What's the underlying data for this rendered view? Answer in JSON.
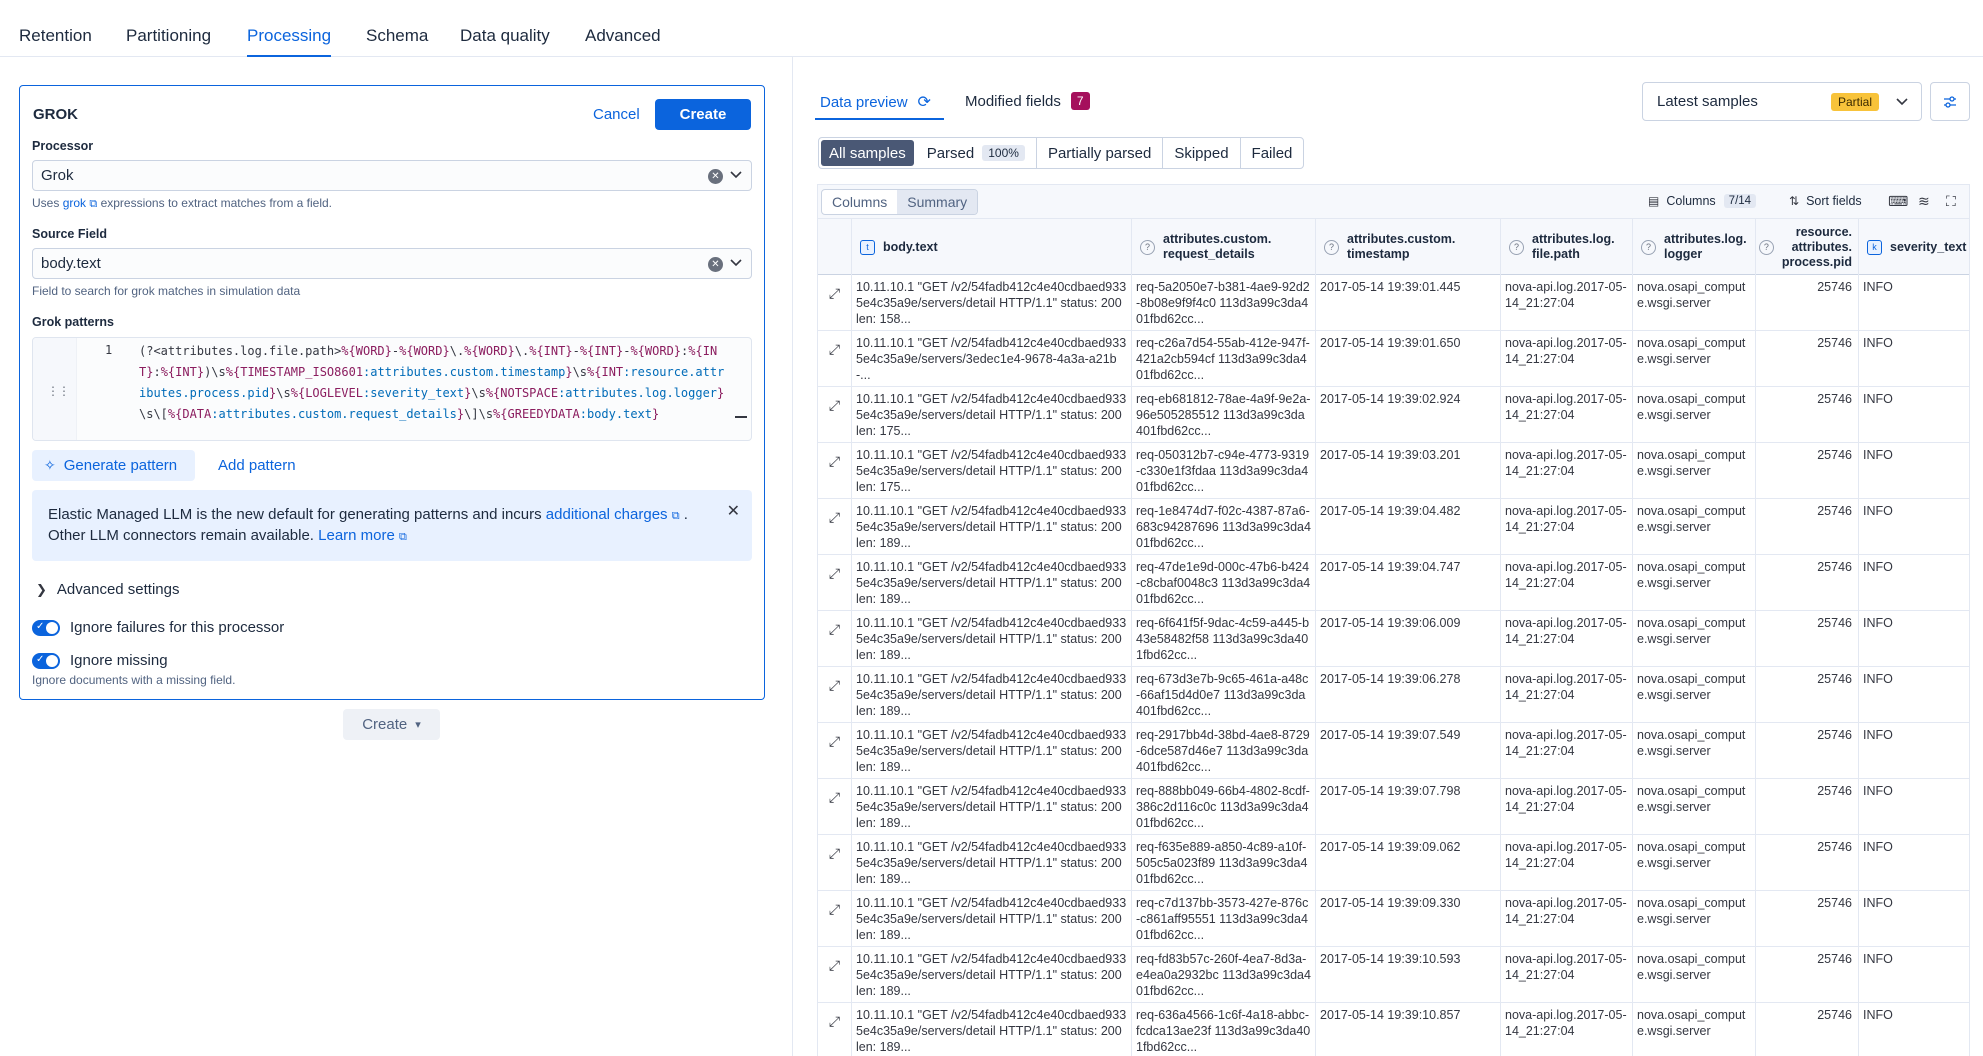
{
  "top_tabs": [
    "Retention",
    "Partitioning",
    "Processing",
    "Schema",
    "Data quality",
    "Advanced"
  ],
  "processor_panel": {
    "title": "GROK",
    "cancel_label": "Cancel",
    "create_label": "Create",
    "processor_label": "Processor",
    "processor_value": "Grok",
    "processor_help_prefix": "Uses",
    "processor_help_link": "grok",
    "processor_help_suffix": "expressions to extract matches from a field.",
    "source_field_label": "Source Field",
    "source_field_value": "body.text",
    "source_field_help": "Field to search for grok matches in simulation data",
    "grok_patterns_label": "Grok patterns",
    "line_number": "1",
    "pattern": "(?<attributes.log.file.path>%{WORD}-%{WORD}\\.%{WORD}\\.%{INT}-%{INT}-%{WORD}:%{INT}:%{INT})\\s%{TIMESTAMP_ISO8601:attributes.custom.timestamp}\\s%{INT:resource.attributes.process.pid}\\s%{LOGLEVEL:severity_text}\\s%{NOTSPACE:attributes.log.logger}\\s\\[%{DATA:attributes.custom.request_details}\\]\\s%{GREEDYDATA:body.text}",
    "generate_label": "Generate pattern",
    "add_pattern_label": "Add pattern",
    "callout_text_1": "Elastic Managed LLM is the new default for generating patterns and incurs",
    "callout_link_1": "additional charges",
    "callout_text_2": ".",
    "callout_text_3": "Other LLM connectors remain available.",
    "callout_link_2": "Learn more",
    "advanced_label": "Advanced settings",
    "toggle_failures_label": "Ignore failures for this processor",
    "toggle_missing_label": "Ignore missing",
    "toggle_missing_help": "Ignore documents with a missing field.",
    "create_dropdown_label": "Create"
  },
  "preview": {
    "tab_preview": "Data preview",
    "tab_modified": "Modified fields",
    "modified_count": "7",
    "samples_select": "Latest samples",
    "samples_badge": "Partial",
    "filters": {
      "all": "All samples",
      "parsed": "Parsed",
      "parsed_pct": "100%",
      "partial": "Partially parsed",
      "skipped": "Skipped",
      "failed": "Failed"
    },
    "toolbar": {
      "columns_tab": "Columns",
      "summary_tab": "Summary",
      "columns_label": "Columns",
      "columns_count": "7/14",
      "sort_label": "Sort fields"
    },
    "headers": [
      {
        "label": "body.text",
        "icon": "t"
      },
      {
        "label": "attributes.custom.\nrequest_details",
        "icon": "?"
      },
      {
        "label": "attributes.custom.\ntimestamp",
        "icon": "?"
      },
      {
        "label": "attributes.log.\nfile.path",
        "icon": "?"
      },
      {
        "label": "attributes.log.\nlogger",
        "icon": "?"
      },
      {
        "label": "resource.\nattributes.\nprocess.pid",
        "icon": "?"
      },
      {
        "label": "severity_text",
        "icon": "k"
      }
    ],
    "rows": [
      {
        "body": "10.11.10.1 \"GET /v2/54fadb412c4e40cdbaed9335e4c35a9e/servers/detail HTTP/1.1\" status: 200 len: 158...",
        "req": "req-5a2050e7-b381-4ae9-92d2-8b08e9f9f4c0 113d3a99c3da401fbd62cc...",
        "ts": "2017-05-14 19:39:01.445",
        "path": "nova-api.log.2017-05-14_21:27:04",
        "logger": "nova.osapi_compute.wsgi.server",
        "pid": "25746",
        "sev": "INFO"
      },
      {
        "body": "10.11.10.1 \"GET /v2/54fadb412c4e40cdbaed9335e4c35a9e/servers/3edec1e4-9678-4a3a-a21b-...",
        "req": "req-c26a7d54-55ab-412e-947f-421a2cb594cf 113d3a99c3da401fbd62cc...",
        "ts": "2017-05-14 19:39:01.650",
        "path": "nova-api.log.2017-05-14_21:27:04",
        "logger": "nova.osapi_compute.wsgi.server",
        "pid": "25746",
        "sev": "INFO"
      },
      {
        "body": "10.11.10.1 \"GET /v2/54fadb412c4e40cdbaed9335e4c35a9e/servers/detail HTTP/1.1\" status: 200 len: 175...",
        "req": "req-eb681812-78ae-4a9f-9e2a-96e505285512 113d3a99c3da401fbd62cc...",
        "ts": "2017-05-14 19:39:02.924",
        "path": "nova-api.log.2017-05-14_21:27:04",
        "logger": "nova.osapi_compute.wsgi.server",
        "pid": "25746",
        "sev": "INFO"
      },
      {
        "body": "10.11.10.1 \"GET /v2/54fadb412c4e40cdbaed9335e4c35a9e/servers/detail HTTP/1.1\" status: 200 len: 175...",
        "req": "req-050312b7-c94e-4773-9319-c330e1f3fdaa 113d3a99c3da401fbd62cc...",
        "ts": "2017-05-14 19:39:03.201",
        "path": "nova-api.log.2017-05-14_21:27:04",
        "logger": "nova.osapi_compute.wsgi.server",
        "pid": "25746",
        "sev": "INFO"
      },
      {
        "body": "10.11.10.1 \"GET /v2/54fadb412c4e40cdbaed9335e4c35a9e/servers/detail HTTP/1.1\" status: 200 len: 189...",
        "req": "req-1e8474d7-f02c-4387-87a6-683c94287696 113d3a99c3da401fbd62cc...",
        "ts": "2017-05-14 19:39:04.482",
        "path": "nova-api.log.2017-05-14_21:27:04",
        "logger": "nova.osapi_compute.wsgi.server",
        "pid": "25746",
        "sev": "INFO"
      },
      {
        "body": "10.11.10.1 \"GET /v2/54fadb412c4e40cdbaed9335e4c35a9e/servers/detail HTTP/1.1\" status: 200 len: 189...",
        "req": "req-47de1e9d-000c-47b6-b424-c8cbaf0048c3 113d3a99c3da401fbd62cc...",
        "ts": "2017-05-14 19:39:04.747",
        "path": "nova-api.log.2017-05-14_21:27:04",
        "logger": "nova.osapi_compute.wsgi.server",
        "pid": "25746",
        "sev": "INFO"
      },
      {
        "body": "10.11.10.1 \"GET /v2/54fadb412c4e40cdbaed9335e4c35a9e/servers/detail HTTP/1.1\" status: 200 len: 189...",
        "req": "req-6f641f5f-9dac-4c59-a445-b43e58482f58 113d3a99c3da401fbd62cc...",
        "ts": "2017-05-14 19:39:06.009",
        "path": "nova-api.log.2017-05-14_21:27:04",
        "logger": "nova.osapi_compute.wsgi.server",
        "pid": "25746",
        "sev": "INFO"
      },
      {
        "body": "10.11.10.1 \"GET /v2/54fadb412c4e40cdbaed9335e4c35a9e/servers/detail HTTP/1.1\" status: 200 len: 189...",
        "req": "req-673d3e7b-9c65-461a-a48c-66af15d4d0e7 113d3a99c3da401fbd62cc...",
        "ts": "2017-05-14 19:39:06.278",
        "path": "nova-api.log.2017-05-14_21:27:04",
        "logger": "nova.osapi_compute.wsgi.server",
        "pid": "25746",
        "sev": "INFO"
      },
      {
        "body": "10.11.10.1 \"GET /v2/54fadb412c4e40cdbaed9335e4c35a9e/servers/detail HTTP/1.1\" status: 200 len: 189...",
        "req": "req-2917bb4d-38bd-4ae8-8729-6dce587d46e7 113d3a99c3da401fbd62cc...",
        "ts": "2017-05-14 19:39:07.549",
        "path": "nova-api.log.2017-05-14_21:27:04",
        "logger": "nova.osapi_compute.wsgi.server",
        "pid": "25746",
        "sev": "INFO"
      },
      {
        "body": "10.11.10.1 \"GET /v2/54fadb412c4e40cdbaed9335e4c35a9e/servers/detail HTTP/1.1\" status: 200 len: 189...",
        "req": "req-888bb049-66b4-4802-8cdf-386c2d116c0c 113d3a99c3da401fbd62cc...",
        "ts": "2017-05-14 19:39:07.798",
        "path": "nova-api.log.2017-05-14_21:27:04",
        "logger": "nova.osapi_compute.wsgi.server",
        "pid": "25746",
        "sev": "INFO"
      },
      {
        "body": "10.11.10.1 \"GET /v2/54fadb412c4e40cdbaed9335e4c35a9e/servers/detail HTTP/1.1\" status: 200 len: 189...",
        "req": "req-f635e889-a850-4c89-a10f-505c5a023f89 113d3a99c3da401fbd62cc...",
        "ts": "2017-05-14 19:39:09.062",
        "path": "nova-api.log.2017-05-14_21:27:04",
        "logger": "nova.osapi_compute.wsgi.server",
        "pid": "25746",
        "sev": "INFO"
      },
      {
        "body": "10.11.10.1 \"GET /v2/54fadb412c4e40cdbaed9335e4c35a9e/servers/detail HTTP/1.1\" status: 200 len: 189...",
        "req": "req-c7d137bb-3573-427e-876c-c861aff95551 113d3a99c3da401fbd62cc...",
        "ts": "2017-05-14 19:39:09.330",
        "path": "nova-api.log.2017-05-14_21:27:04",
        "logger": "nova.osapi_compute.wsgi.server",
        "pid": "25746",
        "sev": "INFO"
      },
      {
        "body": "10.11.10.1 \"GET /v2/54fadb412c4e40cdbaed9335e4c35a9e/servers/detail HTTP/1.1\" status: 200 len: 189...",
        "req": "req-fd83b57c-260f-4ea7-8d3a-e4ea0a2932bc 113d3a99c3da401fbd62cc...",
        "ts": "2017-05-14 19:39:10.593",
        "path": "nova-api.log.2017-05-14_21:27:04",
        "logger": "nova.osapi_compute.wsgi.server",
        "pid": "25746",
        "sev": "INFO"
      },
      {
        "body": "10.11.10.1 \"GET /v2/54fadb412c4e40cdbaed9335e4c35a9e/servers/detail HTTP/1.1\" status: 200 len: 189...",
        "req": "req-636a4566-1c6f-4a18-abbc-fcdca13ae23f 113d3a99c3da401fbd62cc...",
        "ts": "2017-05-14 19:39:10.857",
        "path": "nova-api.log.2017-05-14_21:27:04",
        "logger": "nova.osapi_compute.wsgi.server",
        "pid": "25746",
        "sev": "INFO"
      }
    ]
  }
}
